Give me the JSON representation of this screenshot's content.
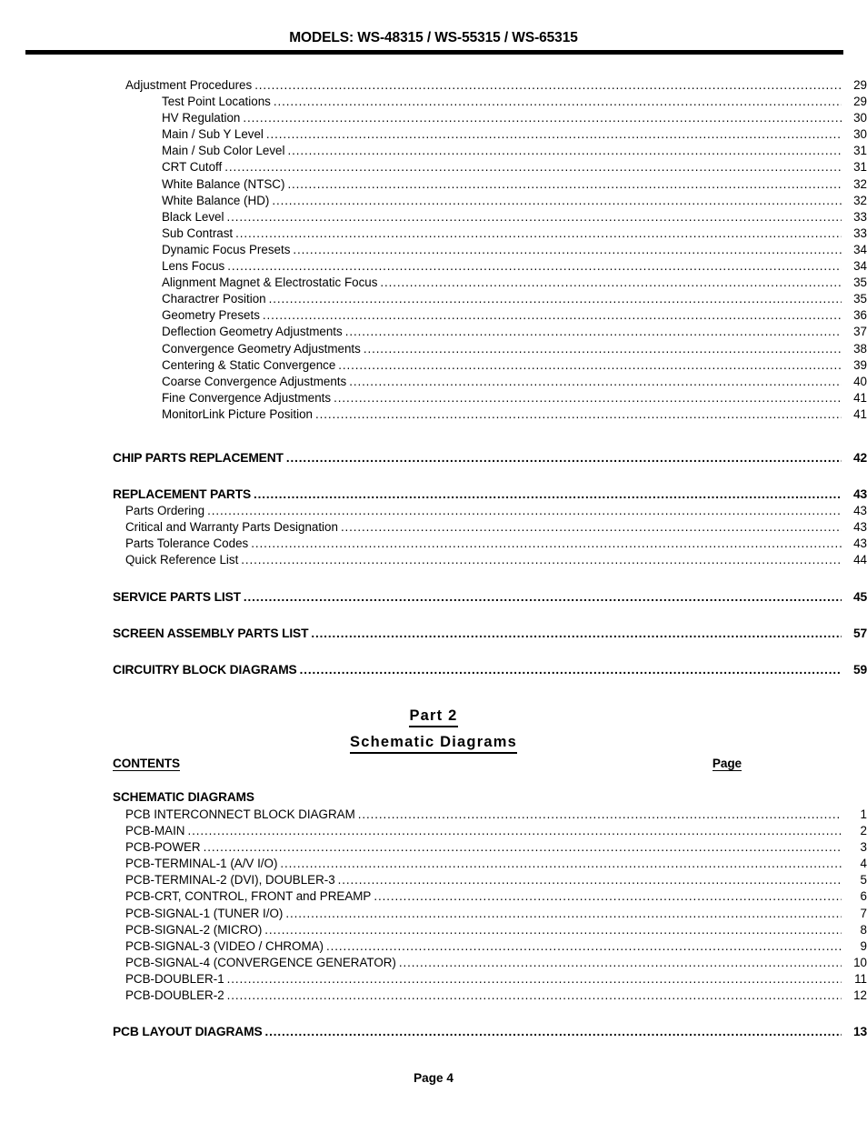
{
  "header": {
    "models_line": "MODELS: WS-48315 / WS-55315 / WS-65315"
  },
  "part1": {
    "entries": [
      {
        "level": "lvl-1",
        "label": "Adjustment Procedures",
        "page": "29"
      },
      {
        "level": "lvl-2",
        "label": "Test Point Locations",
        "page": "29"
      },
      {
        "level": "lvl-2",
        "label": "HV Regulation",
        "page": "30"
      },
      {
        "level": "lvl-2",
        "label": "Main / Sub Y Level",
        "page": "30"
      },
      {
        "level": "lvl-2",
        "label": "Main / Sub Color Level",
        "page": "31"
      },
      {
        "level": "lvl-2",
        "label": "CRT Cutoff",
        "page": "31"
      },
      {
        "level": "lvl-2",
        "label": "White Balance (NTSC)",
        "page": "32"
      },
      {
        "level": "lvl-2",
        "label": "White Balance (HD)",
        "page": "32"
      },
      {
        "level": "lvl-2",
        "label": "Black Level",
        "page": "33"
      },
      {
        "level": "lvl-2",
        "label": "Sub Contrast",
        "page": "33"
      },
      {
        "level": "lvl-2",
        "label": "Dynamic Focus Presets",
        "page": "34"
      },
      {
        "level": "lvl-2",
        "label": "Lens Focus",
        "page": "34"
      },
      {
        "level": "lvl-2",
        "label": "Alignment Magnet & Electrostatic Focus",
        "page": "35"
      },
      {
        "level": "lvl-2",
        "label": "Charactrer Position",
        "page": "35"
      },
      {
        "level": "lvl-2",
        "label": "Geometry Presets",
        "page": "36"
      },
      {
        "level": "lvl-2",
        "label": "Deflection Geometry Adjustments",
        "page": "37"
      },
      {
        "level": "lvl-2",
        "label": "Convergence Geometry Adjustments",
        "page": "38"
      },
      {
        "level": "lvl-2",
        "label": "Centering & Static Convergence",
        "page": "39"
      },
      {
        "level": "lvl-2",
        "label": "Coarse Convergence Adjustments",
        "page": "40"
      },
      {
        "level": "lvl-2",
        "label": "Fine Convergence Adjustments",
        "page": "41"
      },
      {
        "level": "lvl-2",
        "label": "MonitorLink Picture Position",
        "page": "41"
      },
      {
        "level": "gap-lg"
      },
      {
        "level": "lvl-head",
        "label": "CHIP PARTS REPLACEMENT",
        "page": "42"
      },
      {
        "level": "gap-md"
      },
      {
        "level": "lvl-head",
        "label": "REPLACEMENT PARTS",
        "page": "43"
      },
      {
        "level": "lvl-sub",
        "label": "Parts Ordering",
        "page": "43"
      },
      {
        "level": "lvl-sub",
        "label": "Critical and Warranty Parts Designation",
        "page": "43"
      },
      {
        "level": "lvl-sub",
        "label": "Parts Tolerance Codes",
        "page": "43"
      },
      {
        "level": "lvl-sub",
        "label": "Quick Reference List",
        "page": "44"
      },
      {
        "level": "gap-md"
      },
      {
        "level": "lvl-head",
        "label": "SERVICE PARTS LIST",
        "page": "45"
      },
      {
        "level": "gap-md"
      },
      {
        "level": "lvl-head",
        "label": "SCREEN ASSEMBLY PARTS LIST",
        "page": "57"
      },
      {
        "level": "gap-md"
      },
      {
        "level": "lvl-head",
        "label": "CIRCUITRY BLOCK DIAGRAMS",
        "page": "59"
      }
    ]
  },
  "part2_title": {
    "line1": "Part 2",
    "line2": "Schematic  Diagrams"
  },
  "column_headers": {
    "contents": "CONTENTS",
    "page": "Page"
  },
  "part2": {
    "section_heading": "SCHEMATIC DIAGRAMS",
    "entries": [
      {
        "level": "lvl-1",
        "label": "PCB INTERCONNECT BLOCK DIAGRAM",
        "page": "1"
      },
      {
        "level": "lvl-1",
        "label": "PCB-MAIN",
        "page": "2"
      },
      {
        "level": "lvl-1",
        "label": "PCB-POWER",
        "page": "3"
      },
      {
        "level": "lvl-1",
        "label": "PCB-TERMINAL-1 (A/V I/O)",
        "page": "4"
      },
      {
        "level": "lvl-1",
        "label": "PCB-TERMINAL-2 (DVI), DOUBLER-3",
        "page": "5"
      },
      {
        "level": "lvl-1",
        "label": "PCB-CRT, CONTROL, FRONT and PREAMP",
        "page": "6"
      },
      {
        "level": "lvl-1",
        "label": "PCB-SIGNAL-1 (TUNER I/O)",
        "page": "7"
      },
      {
        "level": "lvl-1",
        "label": "PCB-SIGNAL-2 (MICRO)",
        "page": "8"
      },
      {
        "level": "lvl-1",
        "label": "PCB-SIGNAL-3 (VIDEO / CHROMA)",
        "page": "9"
      },
      {
        "level": "lvl-1",
        "label": "PCB-SIGNAL-4 (CONVERGENCE GENERATOR)",
        "page": "10"
      },
      {
        "level": "lvl-1",
        "label": "PCB-DOUBLER-1",
        "page": "11"
      },
      {
        "level": "lvl-1",
        "label": "PCB-DOUBLER-2",
        "page": "12"
      },
      {
        "level": "gap-md"
      },
      {
        "level": "lvl-head",
        "label": "PCB LAYOUT DIAGRAMS",
        "page": "13"
      }
    ]
  },
  "footer": {
    "page_label": "Page 4"
  }
}
